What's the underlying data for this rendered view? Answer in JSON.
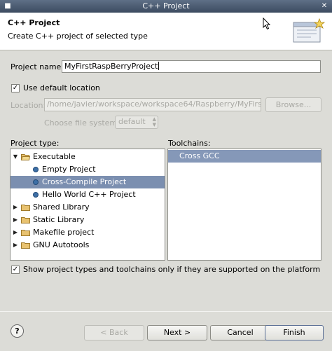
{
  "window": {
    "title": "C++ Project"
  },
  "header": {
    "title": "C++ Project",
    "description": "Create C++ project of selected type"
  },
  "project_name": {
    "label": "Project name:",
    "value": "MyFirstRaspBerryProject"
  },
  "default_location": {
    "label": "Use default location",
    "checked": true
  },
  "location": {
    "label": "Location:",
    "value": "/home/javier/workspace/workspace64/Raspberry/MyFirstRaspB",
    "browse_label": "Browse..."
  },
  "file_system": {
    "label": "Choose file system:",
    "value": "default"
  },
  "project_type": {
    "label": "Project type:",
    "items": [
      {
        "label": "Executable",
        "expanded": true
      },
      {
        "label": "Empty Project"
      },
      {
        "label": "Cross-Compile Project",
        "selected": true
      },
      {
        "label": "Hello World C++ Project"
      },
      {
        "label": "Shared Library",
        "expanded": false
      },
      {
        "label": "Static Library",
        "expanded": false
      },
      {
        "label": "Makefile project",
        "expanded": false
      },
      {
        "label": "GNU Autotools",
        "expanded": false
      }
    ]
  },
  "toolchains": {
    "label": "Toolchains:",
    "items": [
      "Cross GCC"
    ]
  },
  "filter": {
    "label": "Show project types and toolchains only if they are supported on the platform",
    "checked": true
  },
  "buttons": {
    "back": "< Back",
    "next": "Next >",
    "cancel": "Cancel",
    "finish": "Finish",
    "help": "?"
  },
  "colors": {
    "selection": "#7b8fb0",
    "titlebar": "#4b5a70"
  }
}
